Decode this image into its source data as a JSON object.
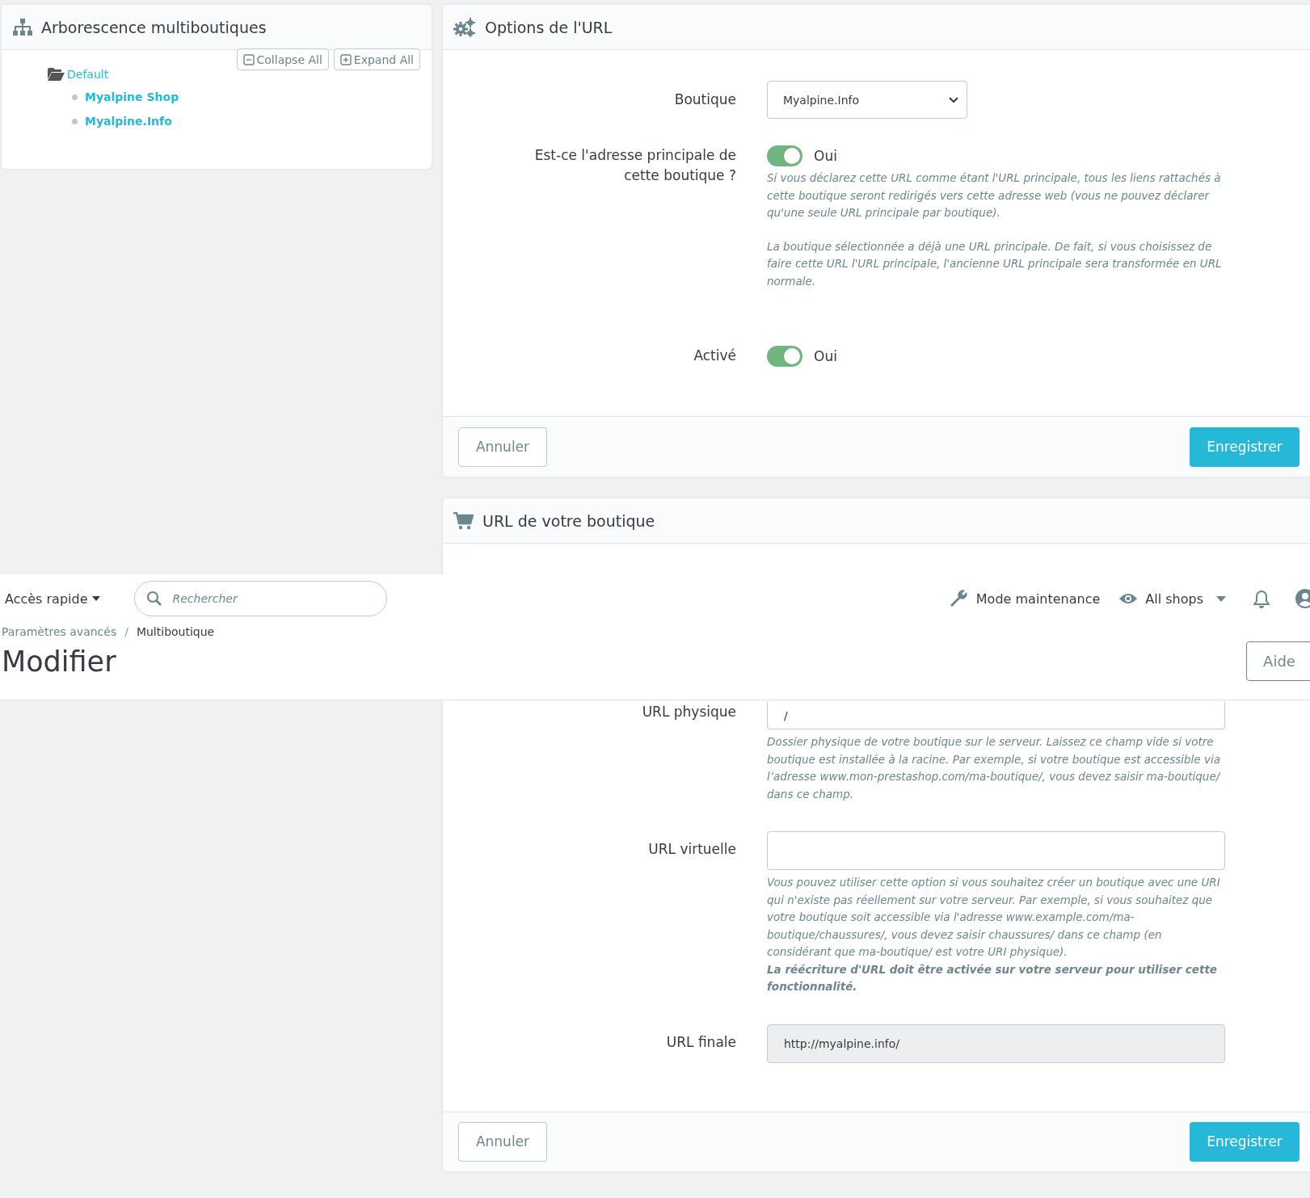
{
  "tree_panel": {
    "title": "Arborescence multiboutiques",
    "buttons": [
      {
        "kind": "collapse",
        "label": "Collapse All"
      },
      {
        "kind": "expand",
        "label": "Expand All"
      }
    ],
    "tree": [
      {
        "label": "Default",
        "expanded": true,
        "children": [
          {
            "label": "Myalpine Shop"
          },
          {
            "label": "Myalpine.Info"
          }
        ]
      }
    ]
  },
  "url_options": {
    "title": "Options de l'URL",
    "fields": [
      {
        "kind": "select",
        "label": "Boutique",
        "value": "Myalpine.Info"
      },
      {
        "kind": "toggle",
        "label": "Est-ce l'adresse principale de cette boutique ?",
        "on": true,
        "state_label": "Oui",
        "help": [
          "Si vous déclarez cette URL comme étant l'URL principale, tous les liens rattachés à cette boutique seront redirigés vers cette adresse web (vous ne pouvez déclarer qu'une seule URL principale par boutique).",
          "La boutique sélectionnée a déjà une URL principale. De fait, si vous choisissez de faire cette URL l'URL principale, l'ancienne URL principale sera transformée en URL normale."
        ]
      },
      {
        "kind": "toggle",
        "label": "Activé",
        "on": true,
        "state_label": "Oui"
      }
    ],
    "cancel": "Annuler",
    "save": "Enregistrer"
  },
  "shop_url": {
    "title": "URL de votre boutique",
    "fields": [
      {
        "kind": "text",
        "label": "URL physique",
        "value": "/",
        "help": [
          "Dossier physique de votre boutique sur le serveur. Laissez ce champ vide si votre boutique est installée à la racine. Par exemple, si votre boutique est accessible via l’adresse www.mon-prestashop.com/ma-boutique/, vous devez saisir ma-boutique/ dans ce champ."
        ]
      },
      {
        "kind": "text",
        "label": "URL virtuelle",
        "help": [
          "Vous pouvez utiliser cette option si vous souhaitez créer un boutique avec une URI qui n'existe pas réellement sur votre serveur. Par exemple, si vous souhaitez que votre boutique soit accessible via l'adresse www.example.com/ma-boutique/chaussures/, vous devez saisir chaussures/ dans ce champ (en considérant que ma-boutique/ est votre URI physique).",
          "**La réécriture d'URL doit être activée sur votre serveur pour utiliser cette fonctionnalité.**"
        ]
      },
      {
        "kind": "readonly",
        "label": "URL finale",
        "value": "http://myalpine.info/"
      }
    ],
    "cancel": "Annuler",
    "save": "Enregistrer"
  },
  "header": {
    "quick_access": "Accès rapide",
    "search_placeholder": "Rechercher",
    "maintenance": "Mode maintenance",
    "shop_selector": "All shops",
    "breadcrumb": {
      "items": [
        "Paramètres avancés",
        "Multiboutique"
      ],
      "separator": "/"
    },
    "page_title": "Modifier",
    "help_button": "Aide"
  }
}
